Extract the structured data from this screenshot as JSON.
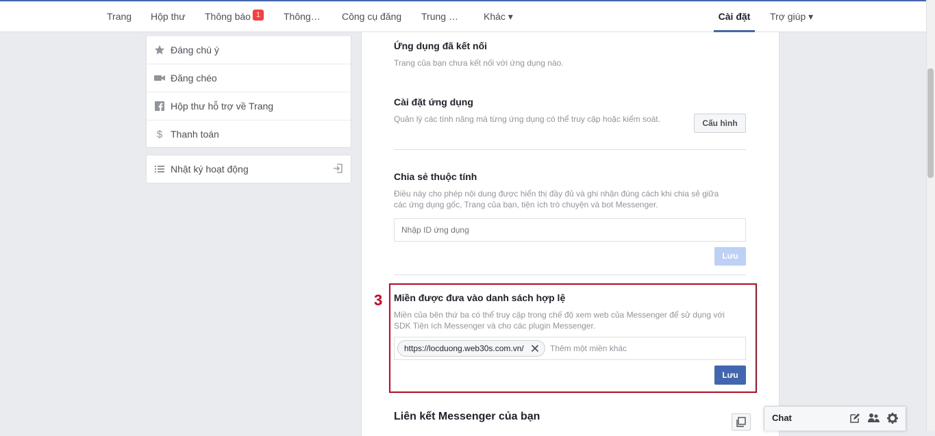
{
  "nav": {
    "items": [
      {
        "label": "Trang"
      },
      {
        "label": "Hộp thư"
      },
      {
        "label": "Thông báo",
        "badge": "1"
      },
      {
        "label": "Thông…"
      },
      {
        "label": "Công cụ đăng"
      },
      {
        "label": "Trung …"
      },
      {
        "label": "Khác ▾"
      }
    ],
    "settings_label": "Cài đặt",
    "help_label": "Trợ giúp ▾"
  },
  "sidebar": {
    "items": [
      {
        "label": "Đáng chú ý",
        "icon": "star-icon"
      },
      {
        "label": "Đăng chéo",
        "icon": "video-camera-icon"
      },
      {
        "label": "Hộp thư hỗ trợ về Trang",
        "icon": "facebook-icon"
      },
      {
        "label": "Thanh toán",
        "icon": "dollar-icon"
      }
    ],
    "activity_log": {
      "label": "Nhật ký hoạt động",
      "icon": "list-icon",
      "action_icon": "export-icon"
    }
  },
  "main": {
    "connected_apps": {
      "title": "Ứng dụng đã kết nối",
      "desc": "Trang của bạn chưa kết nối với ứng dụng nào."
    },
    "app_settings": {
      "title": "Cài đặt ứng dụng",
      "desc": "Quản lý các tính năng mà từng ứng dụng có thể truy cập hoặc kiểm soát.",
      "button": "Cấu hình"
    },
    "attribution": {
      "title": "Chia sẻ thuộc tính",
      "desc": "Điều này cho phép nội dung được hiển thị đầy đủ và ghi nhận đúng cách khi chia sẻ giữa các ứng dụng gốc, Trang của bạn, tiện ích trò chuyện và bot Messenger.",
      "placeholder": "Nhập ID ứng dụng",
      "save": "Lưu"
    },
    "whitelist": {
      "step": "3",
      "title": "Miền được đưa vào danh sách hợp lệ",
      "desc": "Miền của bên thứ ba có thể truy cập trong chế độ xem web của Messenger để sử dụng với SDK Tiện ích Messenger và cho các plugin Messenger.",
      "token": "https://locduong.web30s.com.vn/",
      "placeholder": "Thêm một miền khác",
      "save": "Lưu"
    },
    "messenger_link": {
      "title": "Liên kết Messenger của bạn"
    }
  },
  "chat": {
    "label": "Chat"
  },
  "colors": {
    "accent": "#4267b2",
    "highlight": "#d0021b",
    "badge": "#fa3e3e"
  }
}
